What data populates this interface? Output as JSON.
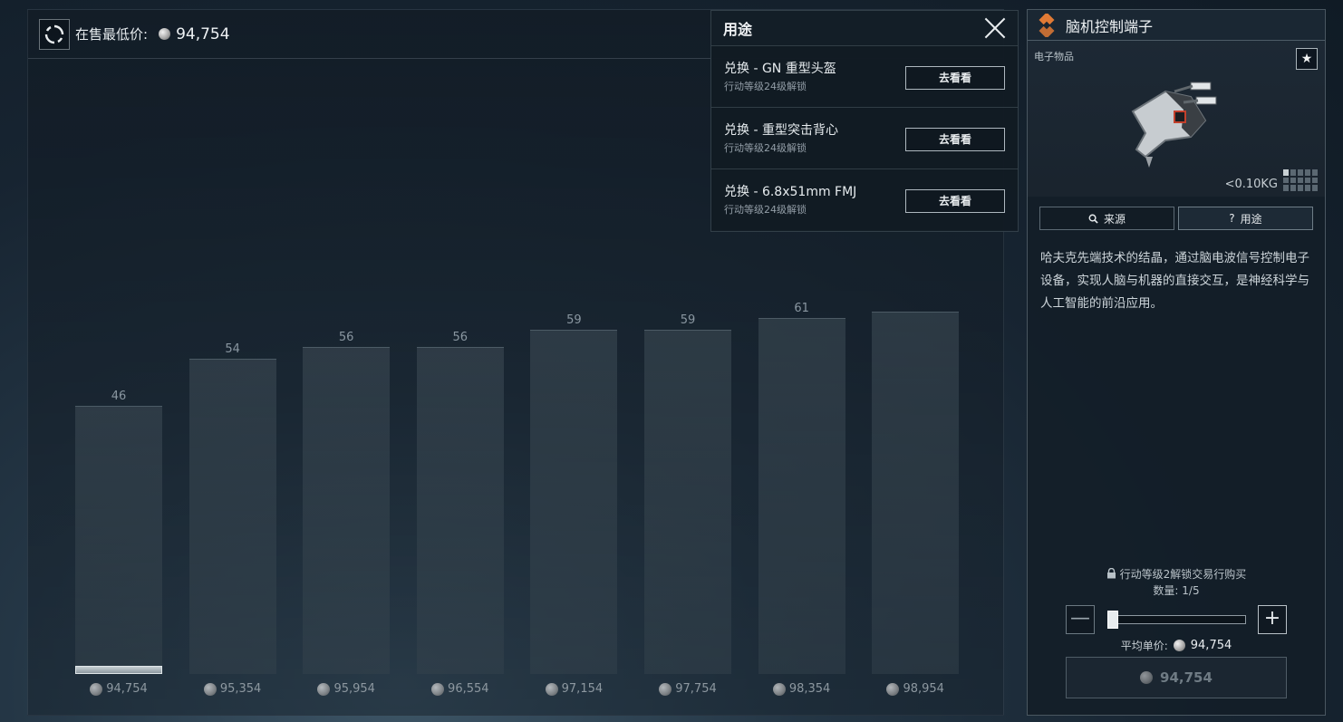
{
  "market": {
    "lowest_price_label": "在售最低价:",
    "lowest_price_value": "94,754",
    "refresh_icon": "refresh-icon",
    "coin_icon": "silver-coin-icon"
  },
  "chart_data": {
    "type": "bar",
    "categories": [
      "94,754",
      "95,354",
      "95,954",
      "96,554",
      "97,154",
      "97,754",
      "98,354",
      "98,954"
    ],
    "values": [
      46,
      54,
      56,
      56,
      59,
      59,
      61,
      62
    ],
    "value_labels": [
      "46",
      "54",
      "56",
      "56",
      "59",
      "59",
      "61",
      ""
    ],
    "ylim": [
      0,
      90
    ],
    "grid": false,
    "selected_index": 0
  },
  "usage_popup": {
    "title": "用途",
    "items": [
      {
        "name": "兑换 - GN 重型头盔",
        "requirement": "行动等级24级解锁",
        "button": "去看看"
      },
      {
        "name": "兑换 - 重型突击背心",
        "requirement": "行动等级24级解锁",
        "button": "去看看"
      },
      {
        "name": "兑换 - 6.8x51mm FMJ",
        "requirement": "行动等级24级解锁",
        "button": "去看看"
      }
    ]
  },
  "item": {
    "name": "脑机控制端子",
    "category": "电子物品",
    "weight": "<0.10KG",
    "favorite_icon": "★",
    "accent_color": "#e07a35",
    "tabs": [
      {
        "label": "来源",
        "icon": "search-icon"
      },
      {
        "label": "用途",
        "icon": "question-icon"
      }
    ],
    "description": "哈夫克先端技术的结晶，通过脑电波信号控制电子设备，实现人脑与机器的直接交互，是神经科学与人工智能的前沿应用。"
  },
  "purchase": {
    "lock_text": "行动等级2解锁交易行购买",
    "quantity_text": "数量: 1/5",
    "quantity_fraction": 0.2,
    "minus_label": "—",
    "plus_label": "+",
    "avg_price_label": "平均单价:",
    "avg_price_value": "94,754",
    "buy_price": "94,754"
  }
}
